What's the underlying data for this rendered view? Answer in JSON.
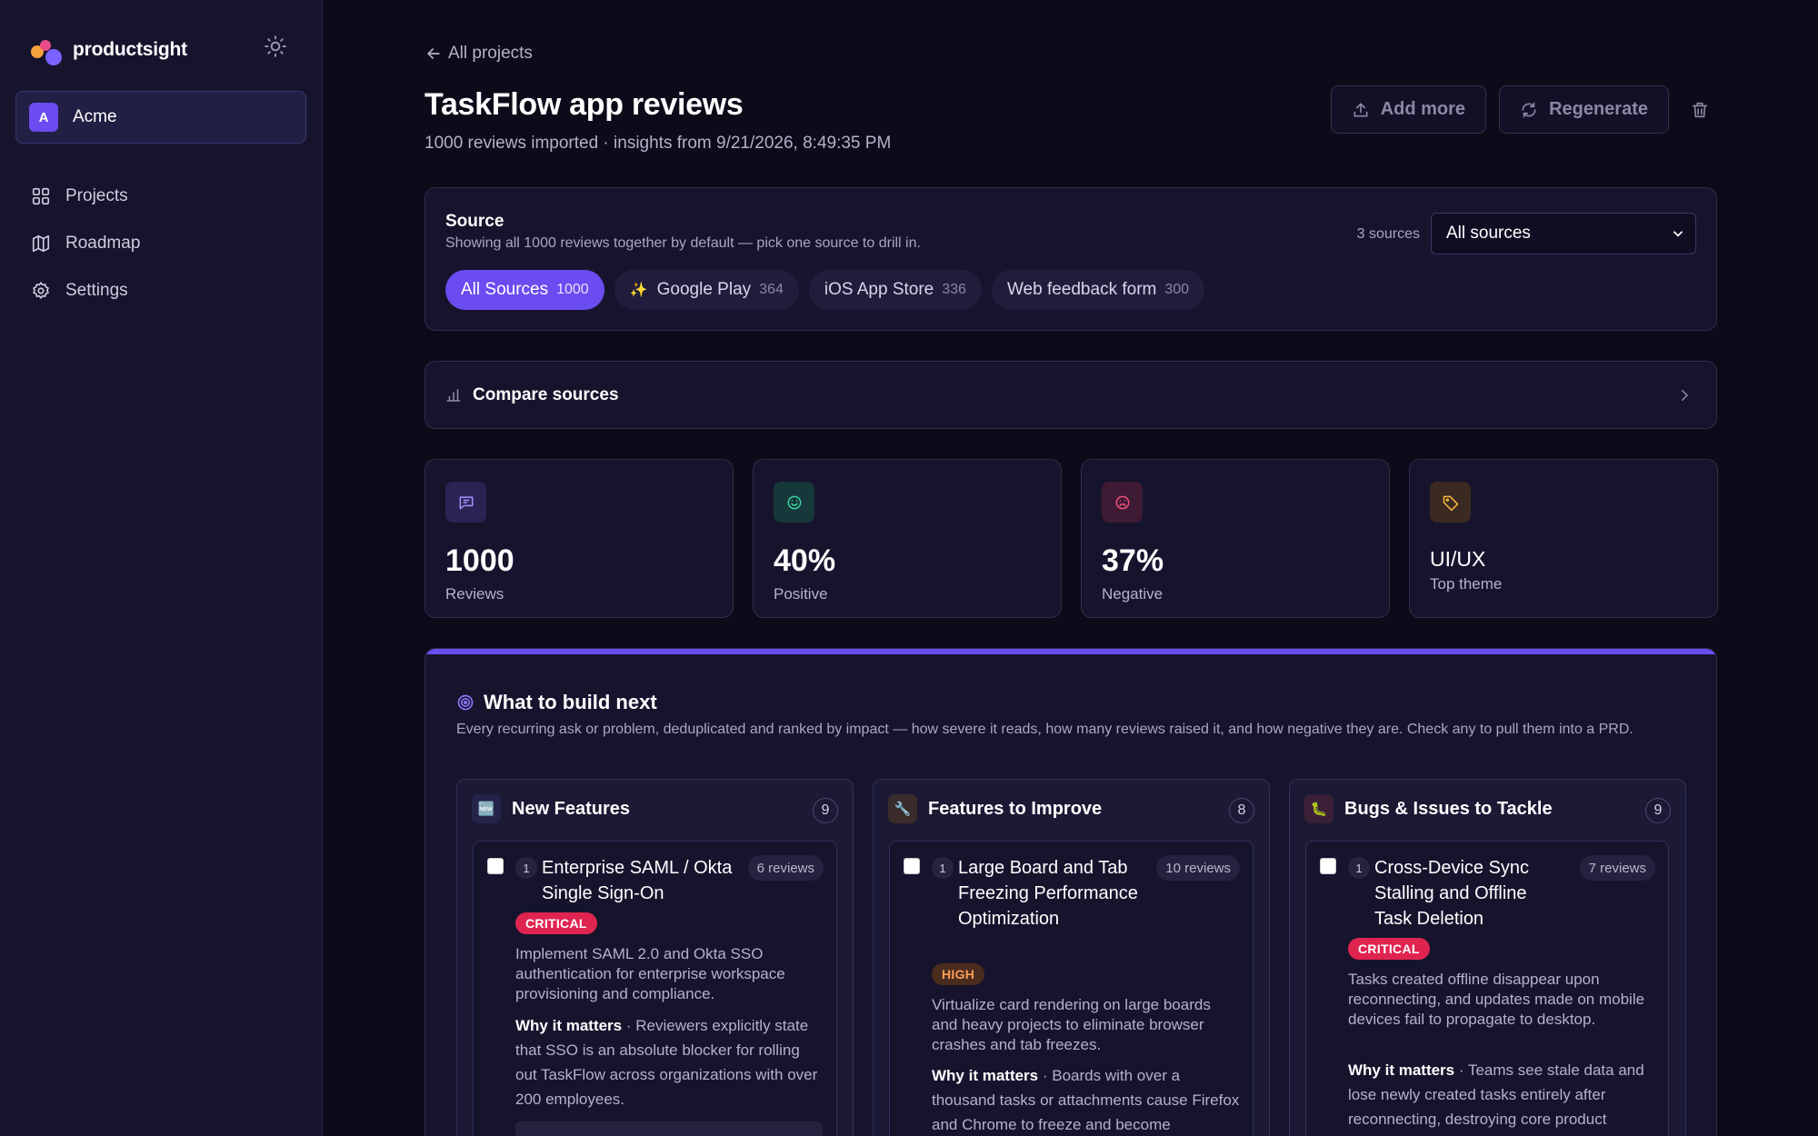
{
  "sidebar": {
    "brand": "productsight",
    "workspace": {
      "initial": "A",
      "name": "Acme"
    },
    "nav": [
      {
        "label": "Projects",
        "icon": "grid-icon"
      },
      {
        "label": "Roadmap",
        "icon": "map-icon"
      },
      {
        "label": "Settings",
        "icon": "gear-icon"
      }
    ]
  },
  "header": {
    "back_label": "All projects",
    "title": "TaskFlow app reviews",
    "subtitle": "1000 reviews imported · insights from 9/21/2026, 8:49:35 PM",
    "add_more": "Add more",
    "regenerate": "Regenerate"
  },
  "source": {
    "title": "Source",
    "description": "Showing all 1000 reviews together by default — pick one source to drill in.",
    "count_label": "3 sources",
    "select_value": "All sources",
    "chips": [
      {
        "label": "All Sources",
        "count": "1000"
      },
      {
        "label": "Google Play",
        "count": "364"
      },
      {
        "label": "iOS App Store",
        "count": "336"
      },
      {
        "label": "Web feedback form",
        "count": "300"
      }
    ]
  },
  "compare": {
    "label": "Compare sources"
  },
  "stats": [
    {
      "value": "1000",
      "label": "Reviews",
      "icon": "chat-icon",
      "color": "#8d77ff"
    },
    {
      "value": "40%",
      "label": "Positive",
      "icon": "smile-icon",
      "color": "#3fd3a0"
    },
    {
      "value": "37%",
      "label": "Negative",
      "icon": "frown-icon",
      "color": "#f0507e"
    },
    {
      "value": "UI/UX",
      "label": "Top theme",
      "icon": "tag-icon",
      "color": "#f6b73c"
    }
  ],
  "build": {
    "title": "What to build next",
    "description": "Every recurring ask or problem, deduplicated and ranked by impact — how severe it reads, how many reviews raised it, and how negative they are. Check any to pull them into a PRD.",
    "columns": [
      {
        "title": "New Features",
        "count": "9",
        "icon": "new-icon",
        "item": {
          "rank": "1",
          "name": "Enterprise SAML / Okta Single Sign-On",
          "reviews": "6 reviews",
          "badge": "CRITICAL",
          "description": "Implement SAML 2.0 and Okta SSO authentication for enterprise workspace provisioning and compliance.",
          "why_label": "Why it matters",
          "why_text": "Reviewers explicitly state that SSO is an absolute blocker for rolling out TaskFlow across organizations with over 200 employees."
        }
      },
      {
        "title": "Features to Improve",
        "count": "8",
        "icon": "wrench-icon",
        "item": {
          "rank": "1",
          "name": "Large Board and Tab Freezing Performance Optimization",
          "reviews": "10 reviews",
          "badge": "HIGH",
          "description": "Virtualize card rendering on large boards and heavy projects to eliminate browser crashes and tab freezes.",
          "why_label": "Why it matters",
          "why_text": "Boards with over a thousand tasks or attachments cause Firefox and Chrome to freeze and become"
        }
      },
      {
        "title": "Bugs & Issues to Tackle",
        "count": "9",
        "icon": "bug-icon",
        "item": {
          "rank": "1",
          "name": "Cross-Device Sync Stalling and Offline Task Deletion",
          "reviews": "7 reviews",
          "badge": "CRITICAL",
          "description": "Tasks created offline disappear upon reconnecting, and updates made on mobile devices fail to propagate to desktop.",
          "why_label": "Why it matters",
          "why_text": "Teams see stale data and lose newly created tasks entirely after reconnecting, destroying core product"
        }
      }
    ]
  }
}
